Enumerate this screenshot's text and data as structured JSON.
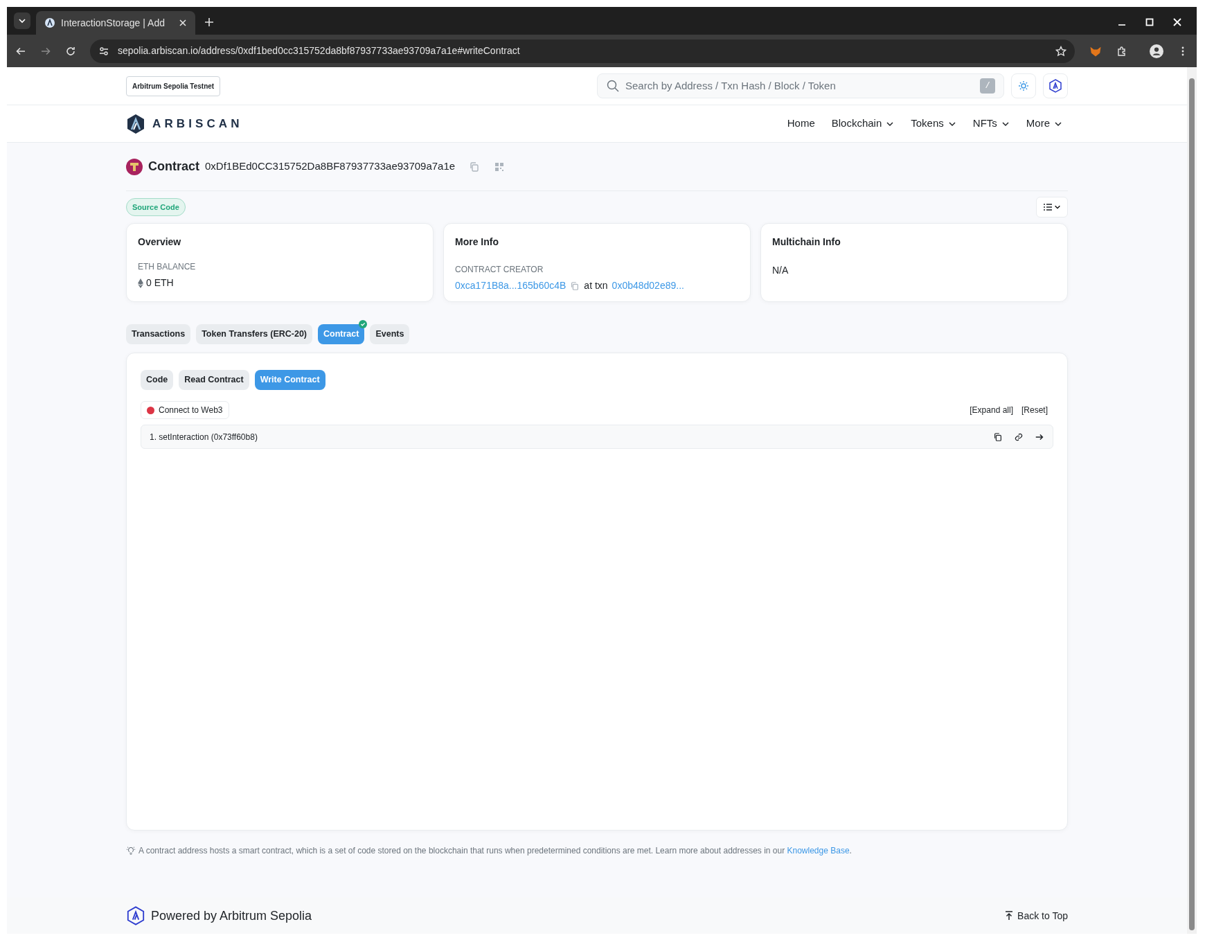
{
  "browser": {
    "tab_title": "InteractionStorage | Add",
    "url": "sepolia.arbiscan.io/address/0xdf1bed0cc315752da8bf87937733ae93709a7a1e#writeContract"
  },
  "network_badge": "Arbitrum Sepolia Testnet",
  "search": {
    "placeholder": "Search by Address / Txn Hash / Block / Token",
    "shortcut": "/"
  },
  "logo": "ARBISCAN",
  "nav": [
    {
      "label": "Home",
      "dropdown": false
    },
    {
      "label": "Blockchain",
      "dropdown": true
    },
    {
      "label": "Tokens",
      "dropdown": true
    },
    {
      "label": "NFTs",
      "dropdown": true
    },
    {
      "label": "More",
      "dropdown": true
    }
  ],
  "contract": {
    "label": "Contract",
    "address": "0xDf1BEd0CC315752Da8BF87937733ae93709a7a1e"
  },
  "source_badge": "Source Code",
  "overview": {
    "title": "Overview",
    "balance_label": "ETH BALANCE",
    "balance": "0 ETH"
  },
  "more_info": {
    "title": "More Info",
    "creator_label": "CONTRACT CREATOR",
    "creator": "0xca171B8a...165b60c4B",
    "at_txn": "at txn",
    "txn": "0x0b48d02e89..."
  },
  "multichain": {
    "title": "Multichain Info",
    "value": "N/A"
  },
  "tabs": [
    {
      "label": "Transactions",
      "selected": false,
      "verified": false
    },
    {
      "label": "Token Transfers (ERC-20)",
      "selected": false,
      "verified": false
    },
    {
      "label": "Contract",
      "selected": true,
      "verified": true
    },
    {
      "label": "Events",
      "selected": false,
      "verified": false
    }
  ],
  "subtabs": [
    {
      "label": "Code",
      "selected": false
    },
    {
      "label": "Read Contract",
      "selected": false
    },
    {
      "label": "Write Contract",
      "selected": true
    }
  ],
  "connect": {
    "label": "Connect to Web3",
    "connected": false
  },
  "links": [
    "[Expand all]",
    "[Reset]"
  ],
  "functions": [
    {
      "label": "1. setInteraction (0x73ff60b8)"
    }
  ],
  "note": "A contract address hosts a smart contract, which is a set of code stored on the blockchain that runs when predetermined conditions are met. Learn more about addresses in our",
  "note_link": "Knowledge Base",
  "note_end": ".",
  "footer": {
    "powered": "Powered by Arbitrum Sepolia",
    "back": "Back to Top"
  }
}
